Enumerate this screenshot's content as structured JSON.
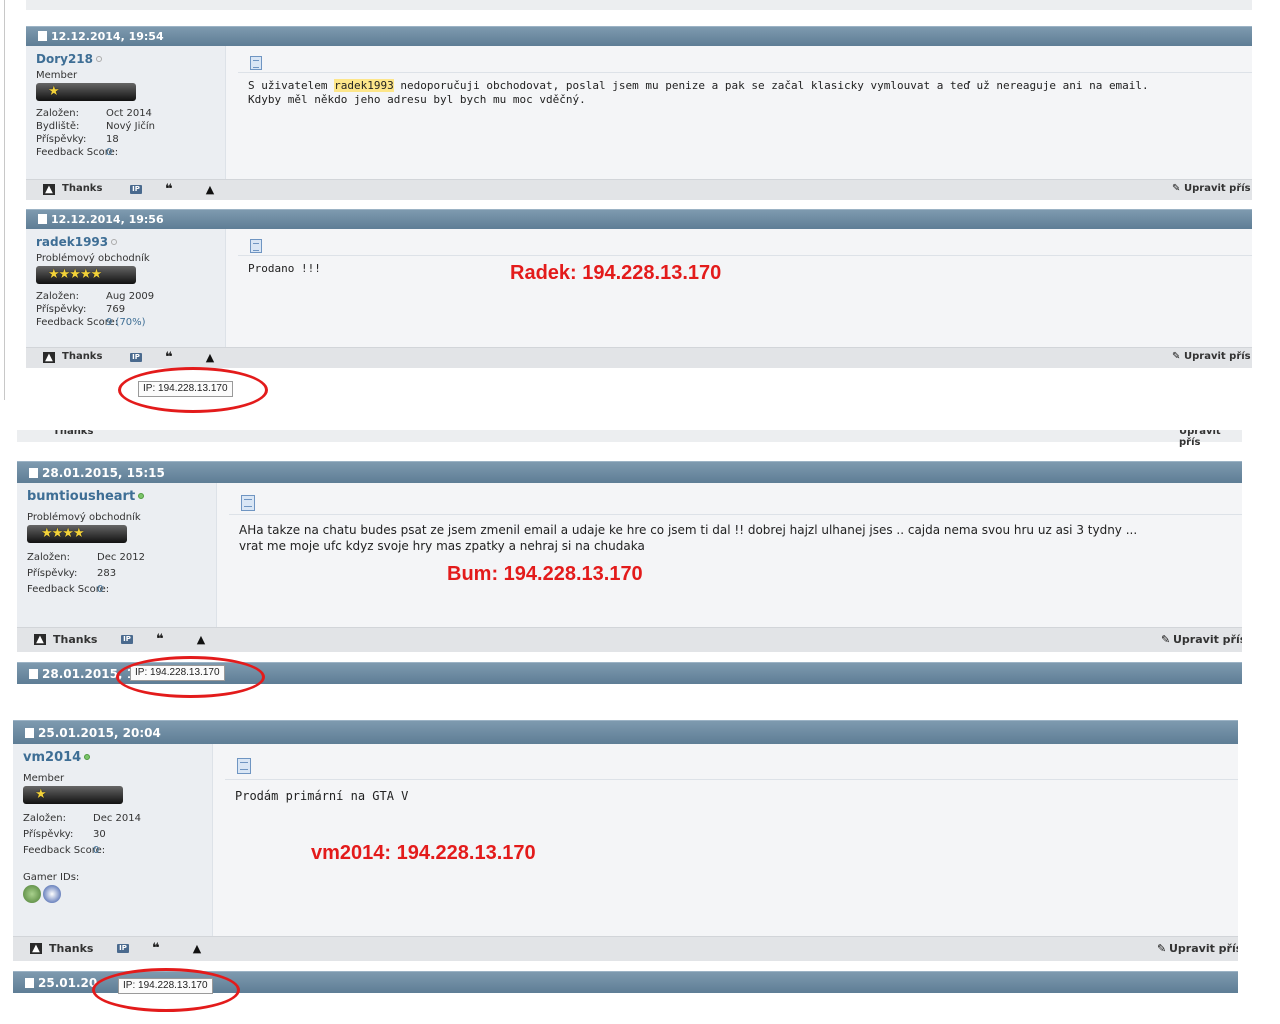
{
  "colors": {
    "header": "#6a879d",
    "annotation_red": "#e31b1b",
    "username": "#3e6e95",
    "highlight": "#fde68a"
  },
  "footer_labels": {
    "thanks": "Thanks",
    "ip_icon_text": "IP",
    "edit": "Upravit přís"
  },
  "block1": {
    "posts": [
      {
        "date": "12.12.2014, 19:54",
        "username": "Dory218",
        "online": false,
        "user_title": "Member",
        "rank_stars": "★",
        "stats": [
          {
            "key": "Založen:",
            "value": "Oct 2014"
          },
          {
            "key": "Bydliště:",
            "value": "Nový Jičín"
          },
          {
            "key": "Příspěvky:",
            "value": "18"
          },
          {
            "key": "Feedback Score:",
            "value": "0"
          }
        ],
        "message_before": "S uživatelem ",
        "message_highlight": "radek1993",
        "message_after": " nedoporučuji obchodovat, poslal jsem mu penize a pak se začal klasicky vymlouvat a teď už nereaguje ani na email.\nKdyby měl někdo jeho adresu byl bych mu moc vděčný."
      },
      {
        "date": "12.12.2014, 19:56",
        "username": "radek1993",
        "online": false,
        "user_title": "Problémový obchodník",
        "rank_stars": "★★★★★",
        "stats": [
          {
            "key": "Založen:",
            "value": "Aug 2009"
          },
          {
            "key": "Příspěvky:",
            "value": "769"
          },
          {
            "key": "Feedback Score:",
            "value": "9 (70%)"
          }
        ],
        "message": "Prodano !!!",
        "annotation": "Radek: 194.228.13.170",
        "tooltip": "IP: 194.228.13.170"
      }
    ]
  },
  "block2": {
    "post": {
      "date": "28.01.2015, 15:15",
      "username": "bumtiousheart",
      "online": true,
      "user_title": "Problémový obchodník",
      "rank_stars": "★★★★",
      "stats": [
        {
          "key": "Založen:",
          "value": "Dec 2012"
        },
        {
          "key": "Příspěvky:",
          "value": "283"
        },
        {
          "key": "Feedback Score:",
          "value": "0"
        }
      ],
      "message": "AHa takze na chatu budes psat ze jsem zmenil email a udaje ke hre co jsem ti dal !! dobrej hajzl ulhanej jses .. cajda nema svou hru uz asi 3 tydny ...\nvrat me moje ufc kdyz svoje hry mas zpatky a nehraj si na chudaka",
      "annotation": "Bum: 194.228.13.170",
      "tooltip": "IP: 194.228.13.170",
      "next_date": "28.01.2015, 1"
    }
  },
  "block3": {
    "post": {
      "date": "25.01.2015, 20:04",
      "username": "vm2014",
      "online": true,
      "user_title": "Member",
      "rank_stars": "★",
      "stats": [
        {
          "key": "Založen:",
          "value": "Dec 2014"
        },
        {
          "key": "Příspěvky:",
          "value": "30"
        },
        {
          "key": "Feedback Score:",
          "value": "0"
        }
      ],
      "gamer_ids_label": "Gamer IDs:",
      "message": "Prodám primární na GTA V",
      "annotation": "vm2014: 194.228.13.170",
      "tooltip": "IP: 194.228.13.170",
      "next_date": "25.01.20"
    }
  }
}
